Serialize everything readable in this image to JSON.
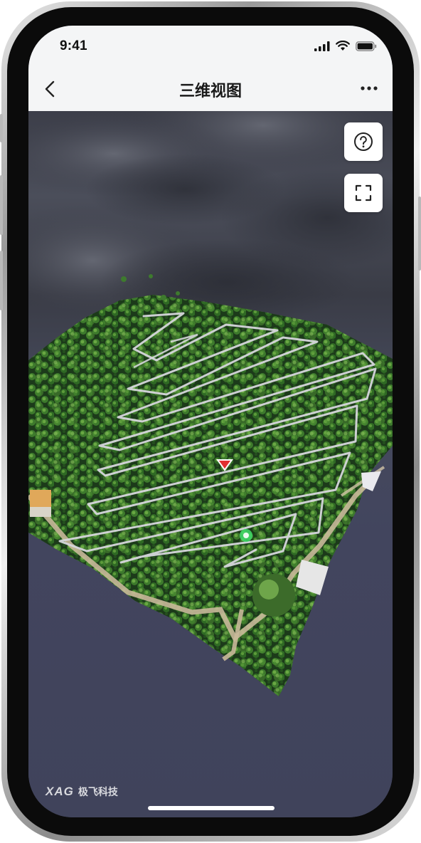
{
  "status_bar": {
    "time": "9:41",
    "icons": [
      "signal-icon",
      "wifi-icon",
      "battery-icon"
    ]
  },
  "nav": {
    "back_icon": "chevron-left-icon",
    "title": "三维视图",
    "more_icon": "more-horizontal-icon"
  },
  "viewer": {
    "help_button_icon": "help-circle-icon",
    "fullscreen_button_icon": "fullscreen-icon",
    "drone_marker_icon": "drone-heading-icon",
    "home_marker_icon": "home-point-icon"
  },
  "brand": {
    "logo": "XAG",
    "name": "极飞科技"
  },
  "colors": {
    "nav_background": "#f4f5f6",
    "sky": "#3c3e49",
    "ground": "#40435b",
    "flight_path": "#d6d6dc",
    "drone_marker": "#e03030",
    "home_marker": "#3fdc6a"
  }
}
